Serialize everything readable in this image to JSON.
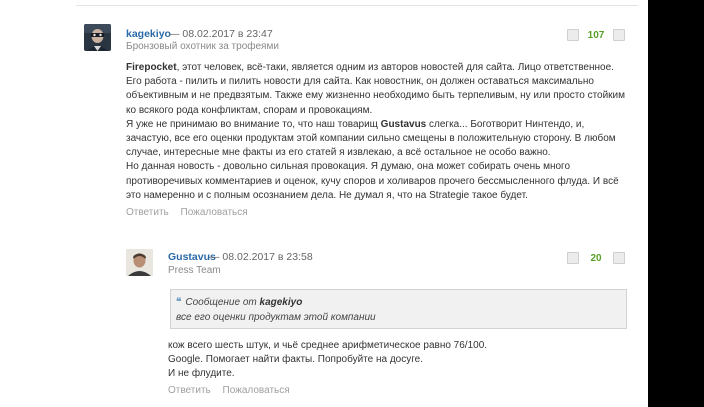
{
  "comments": [
    {
      "author": "kagekiyo",
      "date_prefix": "— 08.02.2017 в 23:47",
      "user_title": "Бронзовый охотник за трофеями",
      "score": "107",
      "avatar_icon": "masked-man-avatar",
      "paragraph1_author": "Firepocket",
      "paragraph1_rest": ", этот человек, всё-таки, является одним из авторов новостей для сайта. Лицо ответственное. Его работа - пилить и пилить новости для сайта. Как новостник, он должен оставаться максимально объективным и не предвзятым. Также ему жизненно необходимо быть терпеливым, ну или просто стойким ко всякого рода конфликтам, спорам и провокациям.",
      "paragraph2_start": "Я уже не принимаю во внимание то, что наш товарищ ",
      "paragraph2_name": "Gustavus",
      "paragraph2_rest": " слегка... Боготворит Нинтендо, и, зачастую, все его оценки продуктам этой компании сильно смещены в положительную сторону. В любом случае, интересные мне факты из его статей я извлекаю, а всё остальное не особо важно.",
      "paragraph3": "Но данная новость - довольно сильная провокация. Я думаю, она может собирать очень много противоречивых комментариев и оценок, кучу споров и холиваров прочего бессмысленного флуда. И всё это намеренно и с полным осознанием дела. Не думал я, что на Strategie такое будет.",
      "reply_label": "Ответить",
      "report_label": "Пожаловаться"
    },
    {
      "author": "Gustavus",
      "date_prefix": "— 08.02.2017 в 23:58",
      "user_title": "Press Team",
      "score": "20",
      "avatar_icon": "man-portrait-avatar",
      "quote_label": "Сообщение от ",
      "quote_author": "kagekiyo",
      "quote_text": "все его оценки продуктам этой компании",
      "line1": "кож всего шесть штук, и чьё среднее арифметическое равно 76/100.",
      "line2": "Google. Помогает найти факты. Попробуйте на досуге.",
      "line3": "И не флудите.",
      "reply_label": "Ответить",
      "report_label": "Пожаловаться"
    }
  ]
}
